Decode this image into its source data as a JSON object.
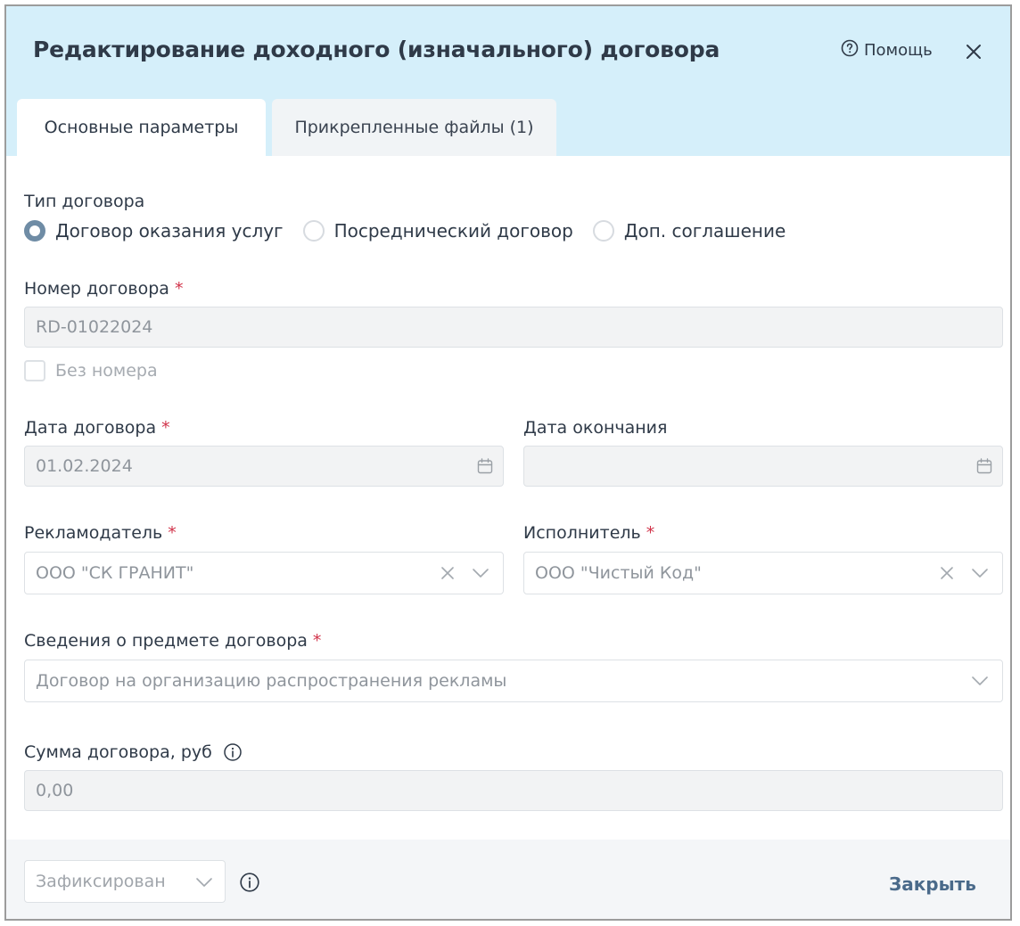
{
  "dialog": {
    "title": "Редактирование доходного (изначального) договора",
    "help_label": "Помощь"
  },
  "tabs": [
    {
      "label": "Основные параметры",
      "active": true
    },
    {
      "label": "Прикрепленные файлы (1)",
      "active": false
    }
  ],
  "form": {
    "contract_type": {
      "label": "Тип договора",
      "options": [
        "Договор оказания услуг",
        "Посреднический договор",
        "Доп. соглашение"
      ],
      "selected": "Договор оказания услуг"
    },
    "contract_number": {
      "label": "Номер договора",
      "required_mark": "*",
      "value": "RD-01022024"
    },
    "no_number": {
      "label": "Без номера",
      "checked": false
    },
    "contract_date": {
      "label": "Дата договора",
      "required_mark": "*",
      "value": "01.02.2024"
    },
    "end_date": {
      "label": "Дата окончания",
      "value": ""
    },
    "advertiser": {
      "label": "Рекламодатель",
      "required_mark": "*",
      "value": "ООО \"СК ГРАНИТ\""
    },
    "executor": {
      "label": "Исполнитель",
      "required_mark": "*",
      "value": "ООО \"Чистый Код\""
    },
    "subject": {
      "label": "Сведения о предмете договора",
      "required_mark": "*",
      "value": "Договор на организацию распространения рекламы"
    },
    "amount": {
      "label": "Сумма договора, руб",
      "value": "0,00"
    }
  },
  "footer": {
    "status_value": "Зафиксирован",
    "close_label": "Закрыть"
  },
  "icons": {
    "help": "help-circle-icon",
    "close": "close-icon",
    "calendar": "calendar-icon",
    "clear": "clear-icon",
    "chevron": "chevron-down-icon",
    "info": "info-icon"
  },
  "colors": {
    "header_bg": "#d5effa",
    "accent": "#6f8ca5",
    "required": "#d1334a",
    "link": "#4a6a8a"
  }
}
